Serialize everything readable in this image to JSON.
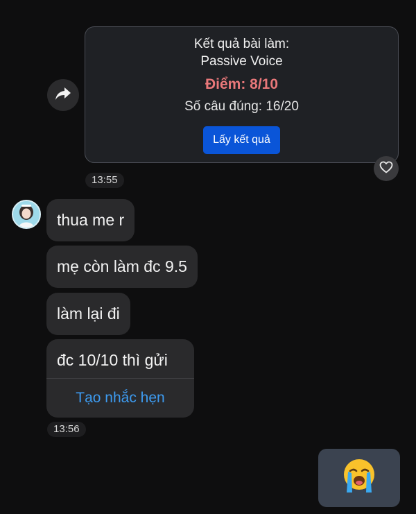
{
  "shared_result": {
    "title_line1": "Kết quả bài làm:",
    "title_line2": "Passive Voice",
    "score": "Điểm: 8/10",
    "correct_count": "Số câu đúng: 16/20",
    "button_label": "Lấy kết quả",
    "share_icon": "share-forward-icon",
    "like_icon": "heart-outline-icon"
  },
  "timestamps": {
    "first": "13:55",
    "second": "13:56"
  },
  "incoming_messages": [
    {
      "text": "thua me r"
    },
    {
      "text": "mẹ còn làm đc 9.5"
    },
    {
      "text": "làm lại đi"
    },
    {
      "text": "đc 10/10 thì gửi",
      "action_label": "Tạo nhắc hẹn"
    }
  ],
  "outgoing_message": {
    "emoji_icon": "loudly-crying-face-icon"
  },
  "colors": {
    "background": "#0e0e0f",
    "bubble": "#2a2a2c",
    "score": "#e9787a",
    "button": "#0a55d8",
    "link": "#3d9bf0",
    "outgoing_bubble": "#3b4350"
  }
}
